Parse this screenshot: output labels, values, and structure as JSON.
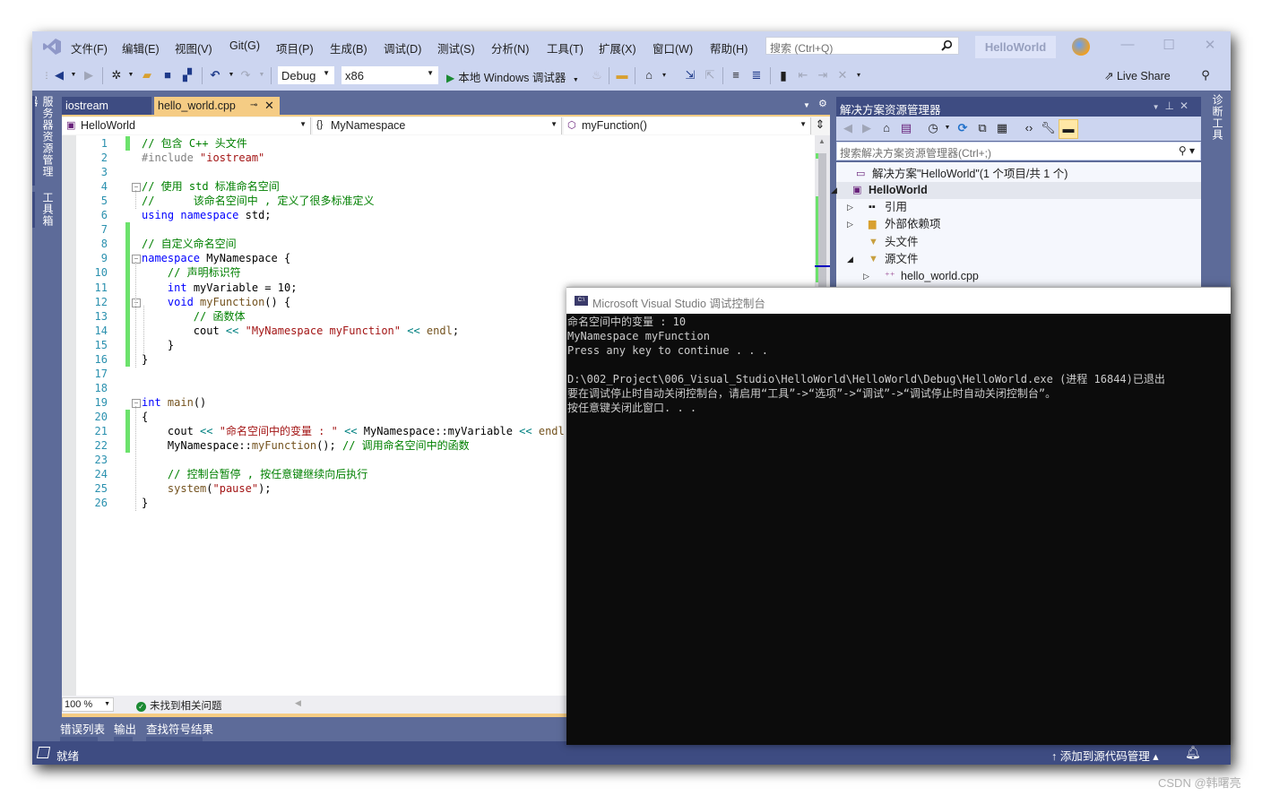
{
  "menubar": {
    "items": [
      "文件(F)",
      "编辑(E)",
      "视图(V)",
      "Git(G)",
      "项目(P)",
      "生成(B)",
      "调试(D)",
      "测试(S)",
      "分析(N)",
      "工具(T)",
      "扩展(X)",
      "窗口(W)",
      "帮助(H)"
    ],
    "search_placeholder": "搜索 (Ctrl+Q)",
    "project_name": "HelloWorld"
  },
  "toolbar": {
    "configuration": "Debug",
    "platform": "x86",
    "run_label": "本地 Windows 调试器",
    "live_share": "Live Share"
  },
  "left_rail": {
    "tabs": [
      "服务器资源管理器",
      "工具箱"
    ]
  },
  "right_rail": {
    "tabs": [
      "诊断工具"
    ]
  },
  "editor": {
    "tabs": [
      {
        "label": "iostream",
        "active": false
      },
      {
        "label": "hello_world.cpp",
        "active": true
      }
    ],
    "nav": {
      "project": "HelloWorld",
      "scope": "MyNamespace",
      "member": "myFunction()"
    },
    "lines": [
      {
        "n": "1",
        "tokens": [
          [
            "cm",
            "// 包含 C++ 头文件"
          ]
        ]
      },
      {
        "n": "2",
        "tokens": [
          [
            "pp",
            "#include "
          ],
          [
            "str",
            "\"iostream\""
          ]
        ]
      },
      {
        "n": "3",
        "tokens": []
      },
      {
        "n": "4",
        "tokens": [
          [
            "cm",
            "// 使用 std 标准命名空间"
          ]
        ]
      },
      {
        "n": "5",
        "tokens": [
          [
            "cm",
            "//      该命名空间中 , 定义了很多标准定义"
          ]
        ]
      },
      {
        "n": "6",
        "tokens": [
          [
            "kw",
            "using"
          ],
          [
            "tx",
            " "
          ],
          [
            "kw",
            "namespace"
          ],
          [
            "tx",
            " std;"
          ]
        ]
      },
      {
        "n": "7",
        "tokens": []
      },
      {
        "n": "8",
        "tokens": [
          [
            "cm",
            "// 自定义命名空间"
          ]
        ]
      },
      {
        "n": "9",
        "tokens": [
          [
            "kw",
            "namespace"
          ],
          [
            "tx",
            " MyNamespace {"
          ]
        ]
      },
      {
        "n": "10",
        "tokens": [
          [
            "tx",
            "    "
          ],
          [
            "cm",
            "// 声明标识符"
          ]
        ]
      },
      {
        "n": "11",
        "tokens": [
          [
            "tx",
            "    "
          ],
          [
            "kw",
            "int"
          ],
          [
            "tx",
            " myVariable = 10;"
          ]
        ]
      },
      {
        "n": "12",
        "tokens": [
          [
            "tx",
            "    "
          ],
          [
            "kw",
            "void"
          ],
          [
            "tx",
            " "
          ],
          [
            "fn",
            "myFunction"
          ],
          [
            "tx",
            "() {"
          ]
        ]
      },
      {
        "n": "13",
        "tokens": [
          [
            "tx",
            "        "
          ],
          [
            "cm",
            "// 函数体"
          ]
        ]
      },
      {
        "n": "14",
        "tokens": [
          [
            "tx",
            "        cout "
          ],
          [
            "op",
            "<<"
          ],
          [
            "tx",
            " "
          ],
          [
            "str",
            "\"MyNamespace myFunction\""
          ],
          [
            "tx",
            " "
          ],
          [
            "op",
            "<<"
          ],
          [
            "tx",
            " "
          ],
          [
            "fn",
            "endl"
          ],
          [
            "tx",
            ";"
          ]
        ]
      },
      {
        "n": "15",
        "tokens": [
          [
            "tx",
            "    }"
          ]
        ]
      },
      {
        "n": "16",
        "tokens": [
          [
            "tx",
            "}"
          ]
        ]
      },
      {
        "n": "17",
        "tokens": []
      },
      {
        "n": "18",
        "tokens": []
      },
      {
        "n": "19",
        "tokens": [
          [
            "kw",
            "int"
          ],
          [
            "tx",
            " "
          ],
          [
            "fn",
            "main"
          ],
          [
            "tx",
            "()"
          ]
        ]
      },
      {
        "n": "20",
        "tokens": [
          [
            "tx",
            "{"
          ]
        ]
      },
      {
        "n": "21",
        "tokens": [
          [
            "tx",
            "    cout "
          ],
          [
            "op",
            "<<"
          ],
          [
            "tx",
            " "
          ],
          [
            "str",
            "\"命名空间中的变量 : \""
          ],
          [
            "tx",
            " "
          ],
          [
            "op",
            "<<"
          ],
          [
            "tx",
            " MyNamespace::myVariable "
          ],
          [
            "op",
            "<<"
          ],
          [
            "tx",
            " "
          ],
          [
            "fn",
            "endl"
          ],
          [
            "tx",
            ";"
          ]
        ]
      },
      {
        "n": "22",
        "tokens": [
          [
            "tx",
            "    MyNamespace::"
          ],
          [
            "fn",
            "myFunction"
          ],
          [
            "tx",
            "(); "
          ],
          [
            "cm",
            "// 调用命名空间中的函数"
          ]
        ]
      },
      {
        "n": "23",
        "tokens": []
      },
      {
        "n": "24",
        "tokens": [
          [
            "tx",
            "    "
          ],
          [
            "cm",
            "// 控制台暂停 , 按任意键继续向后执行"
          ]
        ]
      },
      {
        "n": "25",
        "tokens": [
          [
            "tx",
            "    "
          ],
          [
            "fn",
            "system"
          ],
          [
            "tx",
            "("
          ],
          [
            "str",
            "\"pause\""
          ],
          [
            "tx",
            ");"
          ]
        ]
      },
      {
        "n": "26",
        "tokens": [
          [
            "tx",
            "}"
          ]
        ]
      }
    ],
    "zoom": "100 %",
    "issues": "未找到相关问题"
  },
  "bottom_tabs": [
    "错误列表",
    "输出",
    "查找符号结果"
  ],
  "statusbar": {
    "ready": "就绪",
    "source_control": "添加到源代码管理"
  },
  "solution_explorer": {
    "title": "解决方案资源管理器",
    "search_placeholder": "搜索解决方案资源管理器(Ctrl+;)",
    "tree": [
      {
        "label": "解决方案\"HelloWorld\"(1 个项目/共 1 个)",
        "icon": "solution-icon",
        "level": 0
      },
      {
        "label": "HelloWorld",
        "icon": "project-icon",
        "level": 0,
        "bold": true,
        "expanded": true
      },
      {
        "label": "引用",
        "icon": "references-icon",
        "level": 1,
        "expander": "collapsed"
      },
      {
        "label": "外部依赖项",
        "icon": "external-deps-icon",
        "level": 1,
        "expander": "collapsed"
      },
      {
        "label": "头文件",
        "icon": "filter-folder-icon",
        "level": 1
      },
      {
        "label": "源文件",
        "icon": "filter-folder-icon",
        "level": 1,
        "expander": "expanded"
      },
      {
        "label": "hello_world.cpp",
        "icon": "cpp-file-icon",
        "level": 2,
        "expander": "collapsed"
      }
    ]
  },
  "console": {
    "title": "Microsoft Visual Studio 调试控制台",
    "lines": [
      "命名空间中的变量 : 10",
      "MyNamespace myFunction",
      "Press any key to continue . . .",
      "",
      "D:\\002_Project\\006_Visual_Studio\\HelloWorld\\HelloWorld\\Debug\\HelloWorld.exe (进程 16844)已退出",
      "要在调试停止时自动关闭控制台，请启用“工具”->“选项”->“调试”->“调试停止时自动关闭控制台”。",
      "按任意键关闭此窗口. . ."
    ]
  },
  "watermark": "CSDN @韩曙亮"
}
